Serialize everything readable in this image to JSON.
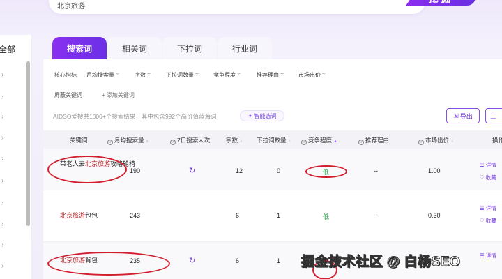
{
  "search": {
    "value": "北京旅游",
    "button": "挖掘"
  },
  "sidebar": {
    "all_label": "全部",
    "chevron": "›"
  },
  "tabs": [
    {
      "label": "搜索词"
    },
    {
      "label": "相关词"
    },
    {
      "label": "下拉词"
    },
    {
      "label": "行业词"
    }
  ],
  "filters": {
    "core_label": "核心指标",
    "dropdowns": [
      "月均搜索量",
      "字数",
      "下拉词数量",
      "竞争程度",
      "推荐理由",
      "市场出价"
    ],
    "mask_label": "屏蔽关键词",
    "add_label": "+ 添加关键词"
  },
  "info_text": "AIDSO爱搜共1000+个搜索结果，其中包含992个高价值蓝海词",
  "smart_button": "✦ 智能选词",
  "export_button": "导出",
  "columns_button": "三",
  "table": {
    "headers": [
      "关键词",
      "月均搜索量",
      "7日搜索人次",
      "字数",
      "下拉词数量",
      "竞争程度",
      "推荐理由",
      "市场出价",
      "操作"
    ],
    "rows": [
      {
        "kw_prefix": "带老人去",
        "kw_hl": "北京旅游",
        "kw_suffix": "攻略轮椅",
        "volume": "190",
        "chars": "12",
        "dropdown": "0",
        "competition": "低",
        "reason": "--",
        "price": "1.00"
      },
      {
        "kw_prefix": "",
        "kw_hl": "北京旅游",
        "kw_suffix": "包包",
        "volume": "243",
        "chars": "6",
        "dropdown": "1",
        "competition": "低",
        "reason": "--",
        "price": "0.30"
      },
      {
        "kw_prefix": "",
        "kw_hl": "北京旅游",
        "kw_suffix": "背包",
        "volume": "235",
        "chars": "6",
        "dropdown": "1",
        "competition": "",
        "reason": "",
        "price": ""
      }
    ],
    "ops": {
      "detail": "☰ 详情",
      "fav": "♡ 收藏"
    }
  },
  "watermark": "掘金技术社区 @ 白杨SEO",
  "colors": {
    "accent": "#7a30e8",
    "highlight": "#c1272d",
    "low": "#1a9b3b",
    "annotation": "#d21f2f"
  },
  "icons": {
    "spinner": "loading-icon",
    "question": "question-icon",
    "export": "export-icon",
    "columns": "columns-icon"
  }
}
